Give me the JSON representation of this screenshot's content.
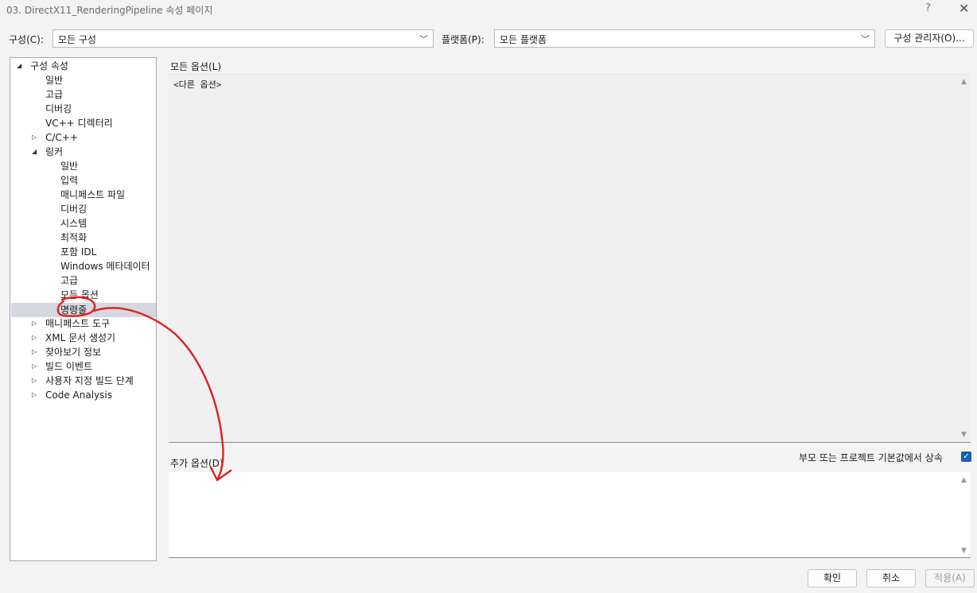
{
  "window": {
    "title": "03. DirectX11_RenderingPipeline 속성 페이지",
    "help": "?",
    "close": "✕"
  },
  "toolbar": {
    "config_label": "구성(C):",
    "config_value": "모든 구성",
    "platform_label": "플랫폼(P):",
    "platform_value": "모든 플랫폼",
    "config_manager_label": "구성 관리자(O)..."
  },
  "tree": {
    "root": "구성 속성",
    "items": [
      {
        "label": "일반"
      },
      {
        "label": "고급"
      },
      {
        "label": "디버깅"
      },
      {
        "label": "VC++ 디렉터리"
      },
      {
        "label": "C/C++"
      },
      {
        "label": "링커"
      }
    ],
    "linker_children": [
      "일반",
      "입력",
      "매니페스트 파일",
      "디버깅",
      "시스템",
      "최적화",
      "포함 IDL",
      "Windows 메타데이터",
      "고급",
      "모든 옵션",
      "명령줄"
    ],
    "after_items": [
      "매니페스트 도구",
      "XML 문서 생성기",
      "찾아보기 정보",
      "빌드 이벤트",
      "사용자 지정 빌드 단계",
      "Code Analysis"
    ],
    "selected": "명령줄"
  },
  "main": {
    "all_options_label": "모든 옵션(L)",
    "all_options_text": "<다른 옵션>",
    "additional_options_label": "추가 옵션(D)",
    "inherit_label": "부모 또는 프로젝트 기본값에서 상속",
    "inherit_checked": true
  },
  "footer": {
    "ok": "확인",
    "cancel": "취소",
    "apply": "적용(A)"
  },
  "colors": {
    "selection": "#d5d8e0",
    "annotation": "#e0201c",
    "checkbox": "#1a5fb4"
  }
}
